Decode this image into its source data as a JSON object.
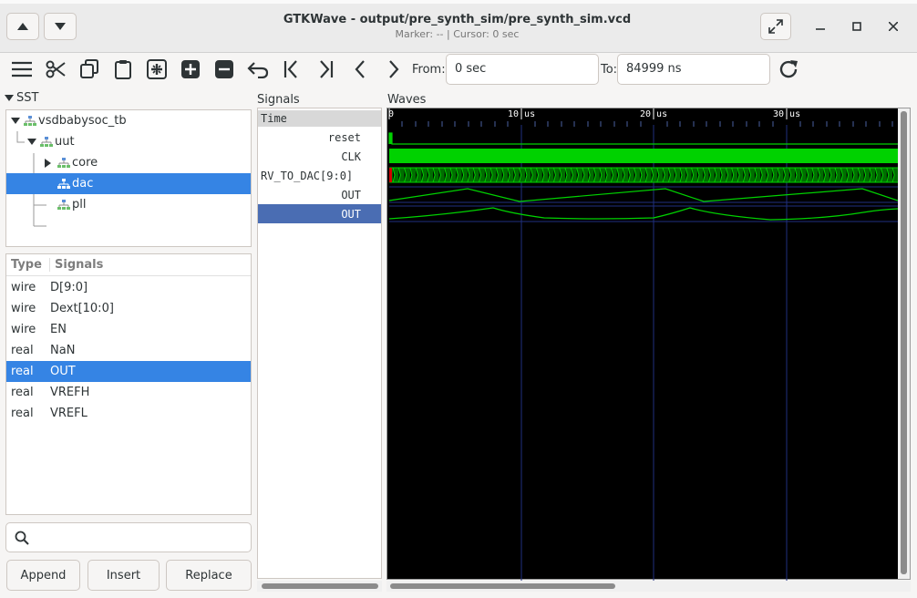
{
  "window": {
    "title": "GTKWave - output/pre_synth_sim/pre_synth_sim.vcd",
    "subtitle": "Marker: --  |  Cursor: 0 sec"
  },
  "toolbar": {
    "from_label": "From:",
    "from_value": "0 sec",
    "to_label": "To:",
    "to_value": "84999 ns"
  },
  "sst": {
    "header": "SST",
    "tree": [
      {
        "label": "vsdbabysoc_tb"
      },
      {
        "label": "uut"
      },
      {
        "label": "core"
      },
      {
        "label": "dac"
      },
      {
        "label": "pll"
      }
    ]
  },
  "signals_table": {
    "col_type": "Type",
    "col_signals": "Signals",
    "rows": [
      {
        "type": "wire",
        "name": "D[9:0]"
      },
      {
        "type": "wire",
        "name": "Dext[10:0]"
      },
      {
        "type": "wire",
        "name": "EN"
      },
      {
        "type": "real",
        "name": "NaN"
      },
      {
        "type": "real",
        "name": "OUT"
      },
      {
        "type": "real",
        "name": "VREFH"
      },
      {
        "type": "real",
        "name": "VREFL"
      }
    ],
    "selected_index": 4
  },
  "search": {
    "placeholder": ""
  },
  "buttons": {
    "append": "Append",
    "insert": "Insert",
    "replace": "Replace"
  },
  "signals_pane": {
    "header": "Signals",
    "time_label": "Time",
    "names": [
      "reset",
      "CLK",
      "RV_TO_DAC[9:0]",
      "OUT",
      "OUT"
    ]
  },
  "waves_pane": {
    "header": "Waves",
    "ticks": [
      "0",
      "10 us",
      "20 us",
      "30 us"
    ]
  },
  "colors": {
    "accent": "#3584e4",
    "wave_green": "#00d200",
    "wave_bg": "#000000",
    "signal_selected": "#4a6db3"
  }
}
